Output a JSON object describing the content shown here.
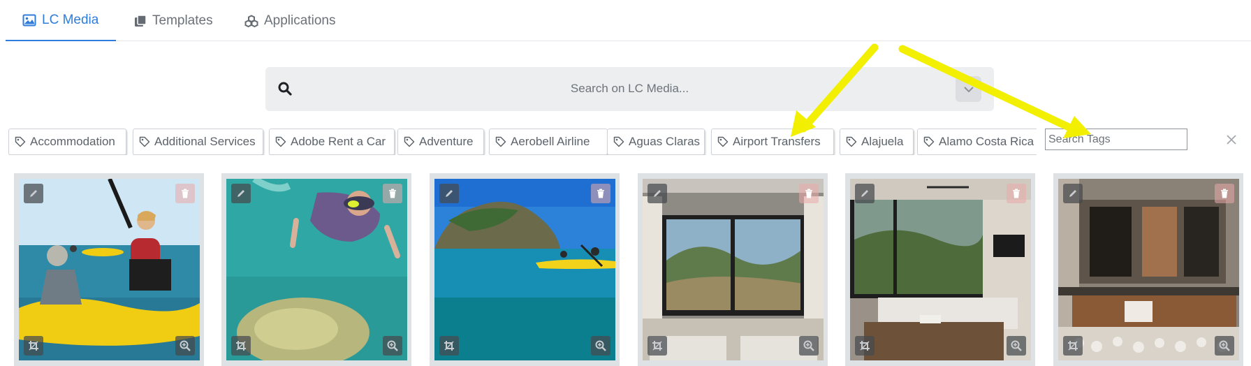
{
  "tabs": [
    {
      "label": "LC Media",
      "icon": "image-icon",
      "active": true
    },
    {
      "label": "Templates",
      "icon": "copy-icon",
      "active": false
    },
    {
      "label": "Applications",
      "icon": "cubes-icon",
      "active": false
    }
  ],
  "search": {
    "placeholder": "Search on LC Media..."
  },
  "tags": [
    "Accommodation",
    "Additional Services",
    "Adobe Rent a Car",
    "Adventure",
    "Aerobell Airline",
    "Aguas Claras",
    "Airport Transfers",
    "Alajuela",
    "Alamo Costa Rica"
  ],
  "tag_search": {
    "placeholder": "Search Tags"
  },
  "media": [
    {
      "subject": "kayak-tour-photo"
    },
    {
      "subject": "snorkeling-photo"
    },
    {
      "subject": "island-kayak-photo"
    },
    {
      "subject": "hotel-window-view-photo"
    },
    {
      "subject": "hotel-bedroom-photo"
    },
    {
      "subject": "bathroom-vanity-photo"
    }
  ],
  "colors": {
    "accent": "#2f7ddb",
    "annotation_arrow": "#f2f000",
    "delete": "#e8a9a9"
  }
}
